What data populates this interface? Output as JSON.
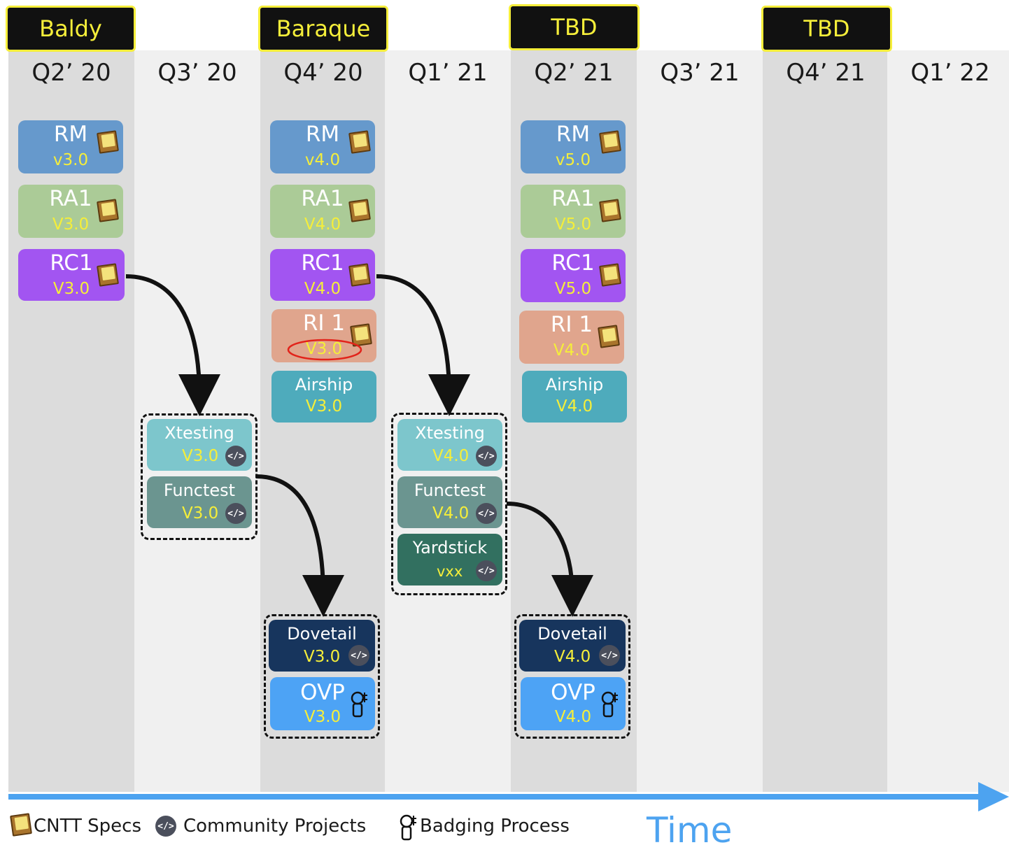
{
  "releases": [
    {
      "label": "Baldy"
    },
    {
      "label": "Baraque"
    },
    {
      "label": "TBD"
    },
    {
      "label": "TBD"
    }
  ],
  "quarters": [
    "Q2’ 20",
    "Q3’ 20",
    "Q4’ 20",
    "Q1’ 21",
    "Q2’ 21",
    "Q3’ 21",
    "Q4’ 21",
    "Q1’ 22"
  ],
  "boxes": {
    "rm_q2_20": {
      "name": "RM",
      "version": "v3.0"
    },
    "ra1_q2_20": {
      "name": "RA1",
      "version": "V3.0"
    },
    "rc1_q2_20": {
      "name": "RC1",
      "version": "V3.0"
    },
    "rm_q4_20": {
      "name": "RM",
      "version": "v4.0"
    },
    "ra1_q4_20": {
      "name": "RA1",
      "version": "V4.0"
    },
    "rc1_q4_20": {
      "name": "RC1",
      "version": "V4.0"
    },
    "ri1_q4_20": {
      "name": "RI 1",
      "version": "V3.0"
    },
    "airship_q4_20": {
      "name": "Airship",
      "version": "V3.0"
    },
    "rm_q2_21": {
      "name": "RM",
      "version": "v5.0"
    },
    "ra1_q2_21": {
      "name": "RA1",
      "version": "V5.0"
    },
    "rc1_q2_21": {
      "name": "RC1",
      "version": "V5.0"
    },
    "ri1_q2_21": {
      "name": "RI 1",
      "version": "V4.0"
    },
    "airship_q2_21": {
      "name": "Airship",
      "version": "V4.0"
    },
    "xtesting_q3_20": {
      "name": "Xtesting",
      "version": "V3.0"
    },
    "functest_q3_20": {
      "name": "Functest",
      "version": "V3.0"
    },
    "xtesting_q1_21": {
      "name": "Xtesting",
      "version": "V4.0"
    },
    "functest_q1_21": {
      "name": "Functest",
      "version": "V4.0"
    },
    "yardstick_q1_21": {
      "name": "Yardstick",
      "version": "vxx"
    },
    "dovetail_q4_20": {
      "name": "Dovetail",
      "version": "V3.0"
    },
    "ovp_q4_20": {
      "name": "OVP",
      "version": "V3.0"
    },
    "dovetail_q2_21": {
      "name": "Dovetail",
      "version": "V4.0"
    },
    "ovp_q2_21": {
      "name": "OVP",
      "version": "V4.0"
    }
  },
  "icons": {
    "spec": "book-icon",
    "community": "code-icon",
    "badging": "badge-ribbon-icon"
  },
  "legend": {
    "specs": "CNTT Specs",
    "community": "Community Projects",
    "badging": "Badging Process"
  },
  "axis_label": "Time",
  "colors": {
    "rm": "#6699cc",
    "ra1": "#abcb97",
    "rc1": "#a255f1",
    "ri1": "#e0a58d",
    "airship": "#4eabbc",
    "xtesting": "#7dc6cc",
    "functest": "#6b9590",
    "yardstick": "#327060",
    "dovetail": "#17355d",
    "ovp": "#4da3f5",
    "version_text": "#f5ee3a",
    "time_arrow": "#4da3f0",
    "column_dark": "#dcdcdc",
    "column_light": "#f0f0f0"
  }
}
